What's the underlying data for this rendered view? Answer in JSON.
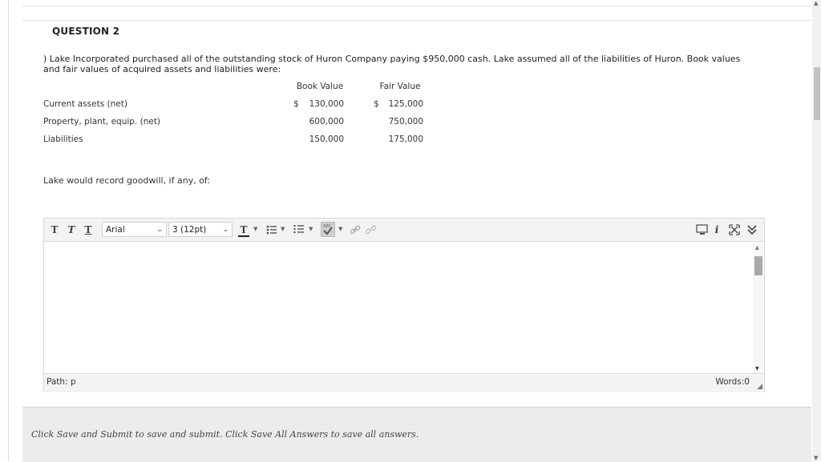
{
  "question": {
    "title": "QUESTION 2",
    "text": ") Lake Incorporated purchased all of the outstanding stock of Huron Company paying $950,000 cash. Lake assumed all of the liabilities of Huron. Book values and fair values of acquired assets and liabilities were:",
    "table": {
      "headers": [
        "Book Value",
        "Fair Value"
      ],
      "rows": [
        {
          "label": "Current assets (net)",
          "book_dollar": "$",
          "book": "130,000",
          "fair_dollar": "$",
          "fair": "125,000"
        },
        {
          "label": "Property, plant, equip. (net)",
          "book_dollar": "",
          "book": "600,000",
          "fair_dollar": "",
          "fair": "750,000"
        },
        {
          "label": "Liabilities",
          "book_dollar": "",
          "book": "150,000",
          "fair_dollar": "",
          "fair": "175,000"
        }
      ]
    },
    "prompt": "Lake would record goodwill, if any, of:"
  },
  "editor": {
    "font_family": "Arial",
    "font_size": "3 (12pt)",
    "path_label": "Path: p",
    "words_label": "Words:0",
    "toolbar_icons": [
      "text-style-1-icon",
      "text-style-2-icon",
      "text-style-3-icon",
      "text-color-icon",
      "bullet-list-icon",
      "numbered-list-icon",
      "spellcheck-icon",
      "link-icon",
      "unlink-icon",
      "preview-icon",
      "info-icon",
      "fullscreen-icon",
      "collapse-icon"
    ]
  },
  "footer": {
    "message": "Click Save and Submit to save and submit. Click Save All Answers to save all answers."
  },
  "colors": {
    "toolbar_bg": "#f3f3f3",
    "footer_bg": "#ececec",
    "border": "#d8d8d8"
  }
}
